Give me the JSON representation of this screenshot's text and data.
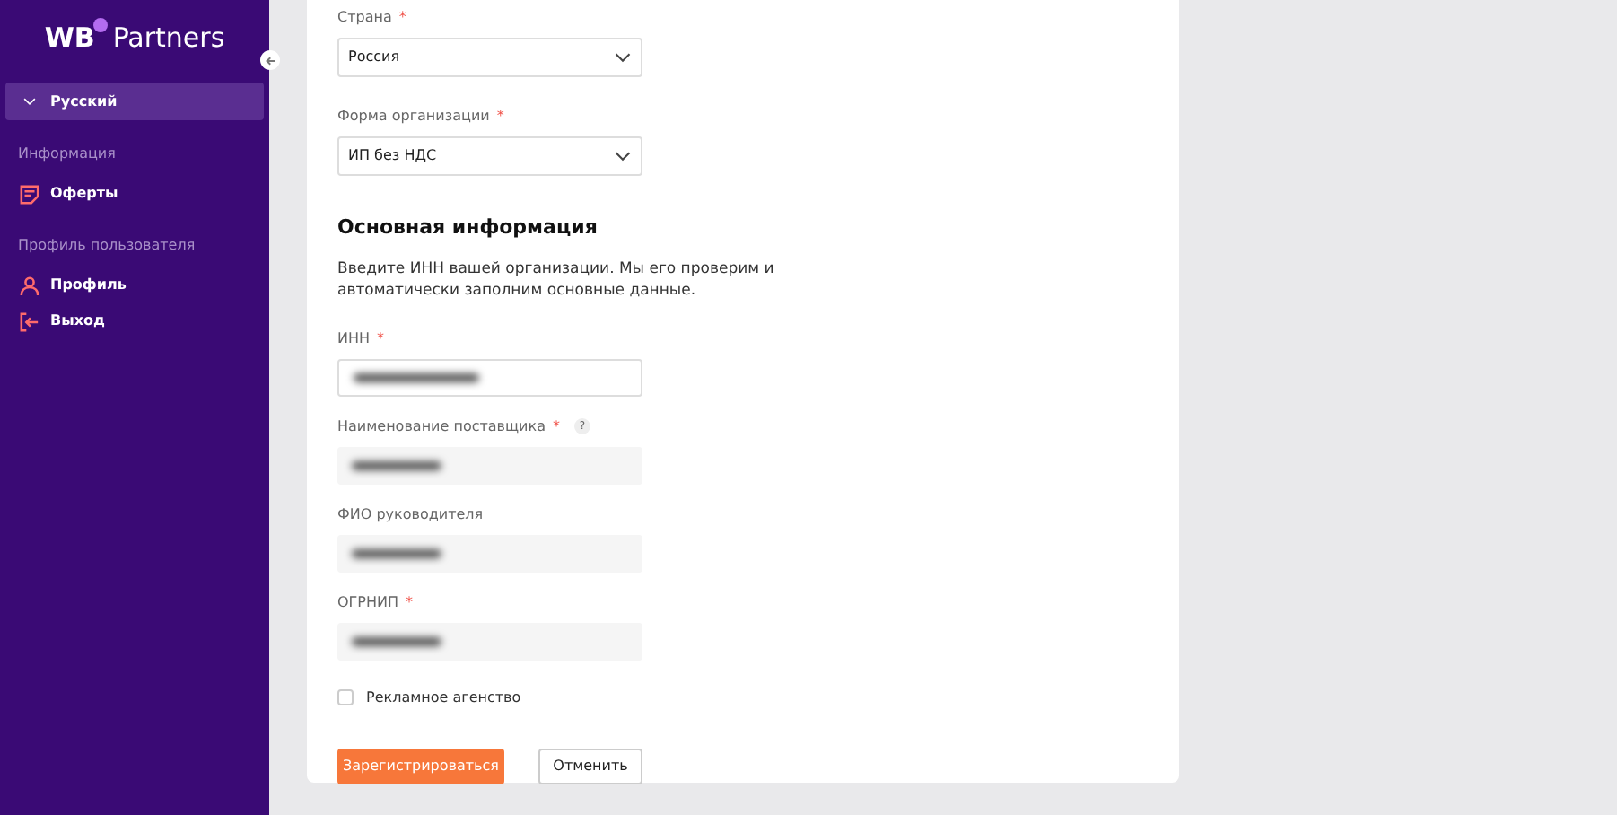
{
  "sidebar": {
    "logo": {
      "left": "WB",
      "right": "Partners"
    },
    "language": {
      "label": "Русский",
      "expanded": true
    },
    "sections": [
      {
        "title": "Информация",
        "items": [
          {
            "label": "Оферты",
            "kind": "document"
          }
        ]
      },
      {
        "title": "Профиль пользователя",
        "items": [
          {
            "label": "Профиль",
            "kind": "user"
          },
          {
            "label": "Выход",
            "kind": "logout"
          }
        ]
      }
    ]
  },
  "form": {
    "top_fields": [
      {
        "label": "Страна",
        "required_mark": "*",
        "kind": "select",
        "value": "Россия"
      },
      {
        "label": "Форма организации",
        "required_mark": "*",
        "kind": "select",
        "value": "ИП без НДС"
      }
    ],
    "section_title": "Основная информация",
    "description": "Введите ИНН вашей организации. Мы его проверим и автоматически заполним основные данные.",
    "fields": [
      {
        "label": "ИНН",
        "required_mark": "*",
        "kind": "input"
      },
      {
        "label": "Наименование поставщика",
        "required_mark": "*",
        "help": "?",
        "kind": "readonly"
      },
      {
        "label": "ФИО руководителя",
        "kind": "readonly"
      },
      {
        "label": "ОГРНИП",
        "required_mark": "*",
        "kind": "readonly"
      }
    ],
    "checkbox": {
      "label": "Рекламное агенство",
      "checked": false
    },
    "buttons": [
      {
        "label": "Зарегистрироваться",
        "kind": "primary"
      },
      {
        "label": "Отменить",
        "kind": "secondary"
      }
    ]
  }
}
